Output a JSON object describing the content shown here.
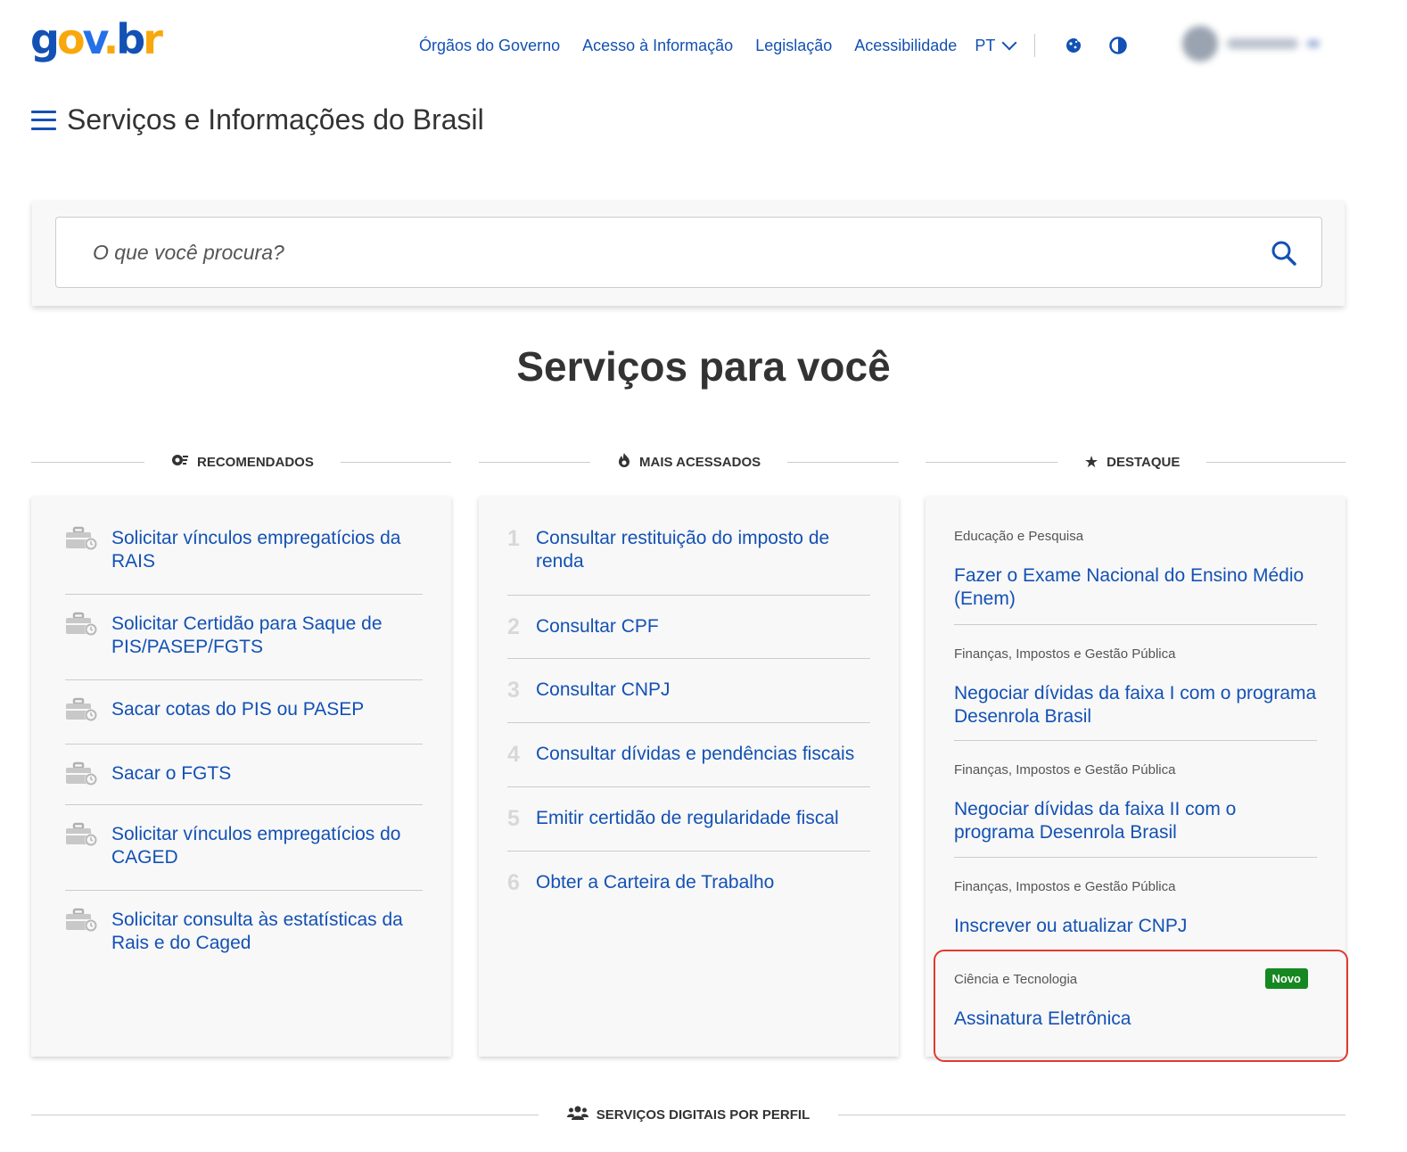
{
  "header": {
    "logo": {
      "g": "g",
      "o1": "o",
      "v": "v",
      "dot": ".",
      "b": "b",
      "r": "r"
    },
    "nav": [
      "Órgãos do Governo",
      "Acesso à Informação",
      "Legislação",
      "Acessibilidade"
    ],
    "language": "PT",
    "icons": [
      "cookie-icon",
      "contrast-icon"
    ],
    "accent": "#1351b4"
  },
  "title": "Serviços e Informações do Brasil",
  "search": {
    "placeholder": "O que você procura?"
  },
  "section_title": "Serviços para você",
  "columns": {
    "recommended": {
      "label": "RECOMENDADOS",
      "items": [
        "Solicitar vínculos empregatícios da RAIS",
        "Solicitar Certidão para Saque de PIS/PASEP/FGTS",
        "Sacar cotas do PIS ou PASEP",
        "Sacar o FGTS",
        "Solicitar vínculos empregatícios do CAGED",
        "Solicitar consulta às estatísticas da Rais e do Caged"
      ]
    },
    "most_accessed": {
      "label": "MAIS ACESSADOS",
      "items": [
        {
          "n": "1",
          "text": "Consultar restituição do imposto de renda"
        },
        {
          "n": "2",
          "text": "Consultar CPF"
        },
        {
          "n": "3",
          "text": "Consultar CNPJ"
        },
        {
          "n": "4",
          "text": "Consultar dívidas e pendências fiscais"
        },
        {
          "n": "5",
          "text": "Emitir certidão de regularidade fiscal"
        },
        {
          "n": "6",
          "text": "Obter a Carteira de Trabalho"
        }
      ]
    },
    "featured": {
      "label": "DESTAQUE",
      "items": [
        {
          "category": "Educação e Pesquisa",
          "text": "Fazer o Exame Nacional do Ensino Médio (Enem)"
        },
        {
          "category": "Finanças, Impostos e Gestão Pública",
          "text": "Negociar dívidas da faixa I com o programa Desenrola Brasil"
        },
        {
          "category": "Finanças, Impostos e Gestão Pública",
          "text": "Negociar dívidas da faixa II com o programa Desenrola Brasil"
        },
        {
          "category": "Finanças, Impostos e Gestão Pública",
          "text": "Inscrever ou atualizar CNPJ"
        },
        {
          "category": "Ciência e Tecnologia",
          "text": "Assinatura Eletrônica",
          "badge": "Novo"
        }
      ]
    }
  },
  "bottom_section": "SERVIÇOS DIGITAIS POR PERFIL",
  "colors": {
    "link": "#1351b4",
    "badge": "#168821",
    "highlight": "#e03a2f"
  }
}
